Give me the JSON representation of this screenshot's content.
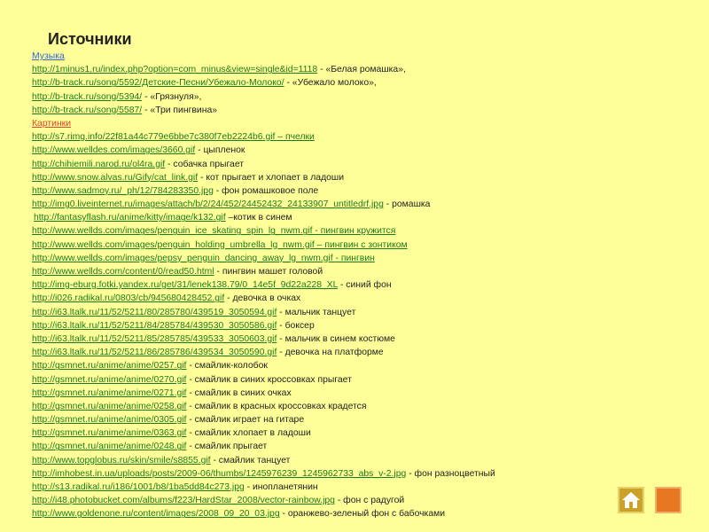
{
  "title": "Источники",
  "music": {
    "heading": "Музыка",
    "items": [
      {
        "url": "http://1minus1.ru/index.php?option=com_minus&view=single&id=1118",
        "desc": " - «Белая ромашка»,"
      },
      {
        "url": "http://b-track.ru/song/5592/Детские-Песни/Убежало-Молоко/",
        "desc": " - «Убежало молоко»,"
      },
      {
        "url": "http://b-track.ru/song/5394/",
        "desc": " - «Грязнуля»,"
      },
      {
        "url": "http://b-track.ru/song/5587/",
        "desc": " - «Три пингвина»"
      }
    ]
  },
  "pictures": {
    "heading": "Картинки",
    "items": [
      {
        "url": "http://s7.rimg.info/22f81a44c779e6bbe7c380f7eb2224b6.gif – пчелки",
        "desc": ""
      },
      {
        "url": "http://www.welldes.com/images/3660.gif",
        "desc": " - цыпленок"
      },
      {
        "url": "http://chihiemili.narod.ru/ol4ra.gif",
        "desc": " - собачка прыгает"
      },
      {
        "url": "http://www.snow.alvas.ru/Gify/cat_link.gif",
        "desc": " - кот прыгает и хлопает в ладоши"
      },
      {
        "url": "http://www.sadmoy.ru/_ph/12/784283350.jpg",
        "desc": " - фон ромашковое поле"
      },
      {
        "url": "http://img0.liveinternet.ru/images/attach/b/2/24/452/24452432_24133907_untitledrf.jpg",
        "desc": " - ромашка"
      },
      {
        "url": "http://fantasyflash.ru/anime/kitty/image/k132.gif",
        "desc": " –котик в синем",
        "indent": true
      },
      {
        "url": "http://www.wellds.com/images/penguin_ice_skating_spin_lg_nwm.gif - пингвин кружится",
        "desc": ""
      },
      {
        "url": "http://www.wellds.com/images/penguin_holding_umbrella_lg_nwm.gif – пингвин с зонтиком",
        "desc": ""
      },
      {
        "url": "http://www.wellds.com/images/pepsy_penguin_dancing_away_lg_nwm.gif - пингвин",
        "desc": ""
      },
      {
        "url": "http://www.wellds.com/content/0/read50.html",
        "desc": " - пингвин машет головой"
      },
      {
        "url": "http://img-eburg.fotki.yandex.ru/get/31/lenek138.79/0_14e5f_9d22a228_XL",
        "desc": " - синий фон"
      },
      {
        "url": "http://i026.radikal.ru/0803/cb/945680428452.gif",
        "desc": " - девочка в очках"
      },
      {
        "url": "http://i63.ltalk.ru/11/52/5211/80/285780/439519_3050594.gif",
        "desc": " - мальчик танцует"
      },
      {
        "url": "http://i63.ltalk.ru/11/52/5211/84/285784/439530_3050586.gif",
        "desc": " -  боксер"
      },
      {
        "url": "http://i63.ltalk.ru/11/52/5211/85/285785/439533_3050603.gif",
        "desc": " - мальчик в синем костюме"
      },
      {
        "url": "http://i63.ltalk.ru/11/52/5211/86/285786/439534_3050590.gif",
        "desc": " - девочка на платформе"
      },
      {
        "url": "http://gsmnet.ru/anime/anime/0257.gif",
        "desc": " - смайлик-колобок"
      },
      {
        "url": "http://gsmnet.ru/anime/anime/0270.gif",
        "desc": " - смайлик в синих кроссовках прыгает"
      },
      {
        "url": "http://gsmnet.ru/anime/anime/0271.gif",
        "desc": " - смайлик в синих очках"
      },
      {
        "url": "http://gsmnet.ru/anime/anime/0258.gif",
        "desc": " - смайлик в красных кроссовках крадется"
      },
      {
        "url": "http://gsmnet.ru/anime/anime/0305.gif",
        "desc": " - смайлик играет на гитаре"
      },
      {
        "url": "http://gsmnet.ru/anime/anime/0363.gif",
        "desc": " - смайлик хлопает в ладоши"
      },
      {
        "url": "http://gsmnet.ru/anime/anime/0248.gif",
        "desc": " - смайлик прыгает"
      },
      {
        "url": "http://www.topglobus.ru/skin/smile/s8855.gif",
        "desc": " - смайлик танцует"
      },
      {
        "url": "http://imhobest.in.ua/uploads/posts/2009-06/thumbs/1245976239_1245962733_abs_v-2.jpg",
        "desc": " - фон разноцветный"
      },
      {
        "url": "http://s13.radikal.ru/i186/1001/b8/1ba5dd84c273.jpg",
        "desc": " - инопланетянин"
      },
      {
        "url": "http://i48.photobucket.com/albums/f223/HardStar_2008/vector-rainbow.jpg",
        "desc": " -   фон с  радугой"
      },
      {
        "url": "http://www.goldenone.ru/content/images/2008_09_20_03.jpg",
        "desc": " - оранжево-зеленый  фон с бабочками"
      }
    ]
  },
  "nav": {
    "home_icon": "home-icon",
    "next_icon": "next-slide-icon"
  }
}
